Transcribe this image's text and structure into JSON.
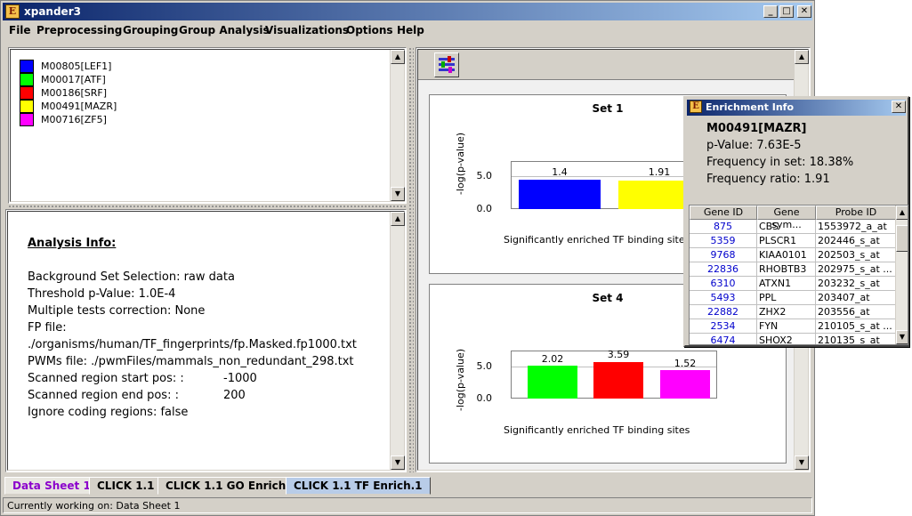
{
  "window": {
    "title": "xpander3",
    "app_icon": "E"
  },
  "menu": [
    "File",
    "Preprocessing",
    "Grouping",
    "Group Analysis",
    "Visualizations",
    "Options",
    "Help"
  ],
  "legend": [
    {
      "label": "M00805[LEF1]",
      "color": "#0000ff"
    },
    {
      "label": "M00017[ATF]",
      "color": "#00ff00"
    },
    {
      "label": "M00186[SRF]",
      "color": "#ff0000"
    },
    {
      "label": "M00491[MAZR]",
      "color": "#ffff00"
    },
    {
      "label": "M00716[ZF5]",
      "color": "#ff00ff"
    }
  ],
  "analysis": {
    "title": "Analysis Info:",
    "lines": [
      "Background Set Selection: raw data",
      "Threshold p-Value: 1.0E-4",
      "Multiple tests correction: None",
      "FP file:",
      "./organisms/human/TF_fingerprints/fp.Masked.fp1000.txt",
      "PWMs file:  ./pwmFiles/mammals_non_redundant_298.txt",
      "Scanned region start pos:  :",
      "Scanned region end pos:  :",
      "Ignore coding regions: false"
    ],
    "values": {
      "start": "-1000",
      "end": "200"
    }
  },
  "charts": [
    {
      "title": "Set 1",
      "ylabel": "-log(p-value)",
      "xlabel": "Significantly enriched TF binding sites",
      "ticks": [
        "5.0",
        "0.0"
      ],
      "bars": [
        {
          "label": "1.4",
          "color": "#0000ff"
        },
        {
          "label": "1.91",
          "color": "#ffff00"
        }
      ]
    },
    {
      "title": "Set 4",
      "ylabel": "-log(p-value)",
      "xlabel": "Significantly enriched TF binding sites",
      "ticks": [
        "5.0",
        "0.0"
      ],
      "bars": [
        {
          "label": "2.02",
          "color": "#00ff00"
        },
        {
          "label": "3.59",
          "color": "#ff0000"
        },
        {
          "label": "1.52",
          "color": "#ff00ff"
        }
      ]
    }
  ],
  "tabs": [
    "Data Sheet 1",
    "CLICK 1.1",
    "CLICK 1.1 GO Enrich.2",
    "CLICK 1.1 TF Enrich.1"
  ],
  "status": "Currently working on: Data Sheet 1",
  "enrichment": {
    "title": "Enrichment Info",
    "motif": "M00491[MAZR]",
    "pvalue": "p-Value: 7.63E-5",
    "freq_in_set": "Frequency in set: 18.38%",
    "freq_ratio": "Frequency ratio: 1.91",
    "columns": [
      "Gene ID",
      "Gene sym...",
      "Probe ID"
    ],
    "rows": [
      [
        "875",
        "CBS",
        "1553972_a_at"
      ],
      [
        "5359",
        "PLSCR1",
        "202446_s_at"
      ],
      [
        "9768",
        "KIAA0101",
        "202503_s_at"
      ],
      [
        "22836",
        "RHOBTB3",
        "202975_s_at ..."
      ],
      [
        "6310",
        "ATXN1",
        "203232_s_at"
      ],
      [
        "5493",
        "PPL",
        "203407_at"
      ],
      [
        "22882",
        "ZHX2",
        "203556_at"
      ],
      [
        "2534",
        "FYN",
        "210105_s_at ..."
      ],
      [
        "6474",
        "SHOX2",
        "210135_s_at"
      ]
    ]
  }
}
